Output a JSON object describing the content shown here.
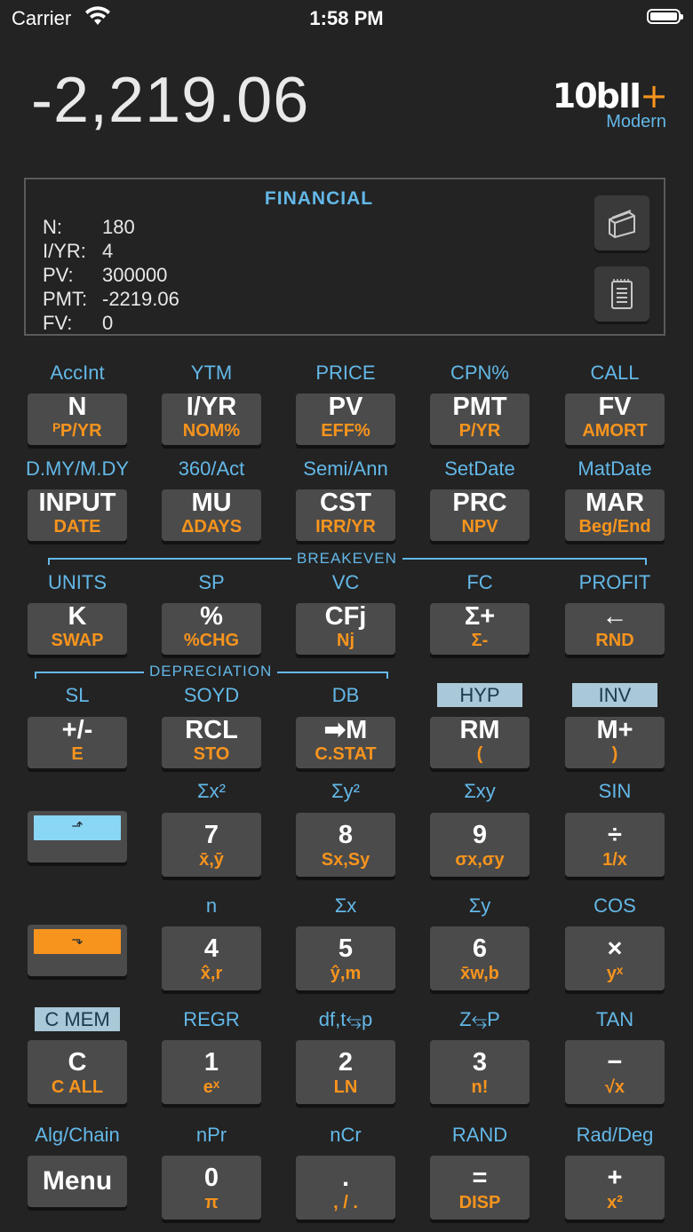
{
  "status": {
    "carrier": "Carrier",
    "time": "1:58 PM"
  },
  "display": {
    "value": "-2,219.06"
  },
  "logo": {
    "brand": "10bII",
    "plus": "+",
    "sub": "Modern"
  },
  "panel": {
    "title": "FINANCIAL",
    "rows": [
      {
        "k": "N:",
        "v": "180"
      },
      {
        "k": "I/YR:",
        "v": "4"
      },
      {
        "k": "PV:",
        "v": "300000"
      },
      {
        "k": "PMT:",
        "v": "-2219.06"
      },
      {
        "k": "FV:",
        "v": "0"
      }
    ]
  },
  "brackets": {
    "breakeven": "BREAKEVEN",
    "depreciation": "DEPRECIATION"
  },
  "rows": [
    {
      "labels": [
        "AccInt",
        "YTM",
        "PRICE",
        "CPN%",
        "CALL"
      ],
      "keys": [
        [
          "N",
          "ᴾP/YR"
        ],
        [
          "I/YR",
          "NOM%"
        ],
        [
          "PV",
          "EFF%"
        ],
        [
          "PMT",
          "P/YR"
        ],
        [
          "FV",
          "AMORT"
        ]
      ]
    },
    {
      "labels": [
        "D.MY/M.DY",
        "360/Act",
        "Semi/Ann",
        "SetDate",
        "MatDate"
      ],
      "keys": [
        [
          "INPUT",
          "DATE"
        ],
        [
          "MU",
          "ΔDAYS"
        ],
        [
          "CST",
          "IRR/YR"
        ],
        [
          "PRC",
          "NPV"
        ],
        [
          "MAR",
          "Beg/End"
        ]
      ]
    },
    {
      "labels": [
        "UNITS",
        "SP",
        "VC",
        "FC",
        "PROFIT"
      ],
      "keys": [
        [
          "K",
          "SWAP"
        ],
        [
          "%",
          "%CHG"
        ],
        [
          "CFj",
          "Nj"
        ],
        [
          "Σ+",
          "Σ-"
        ],
        [
          "←",
          "RND"
        ]
      ]
    },
    {
      "labels": [
        "SL",
        "SOYD",
        "DB",
        "HYP",
        "INV"
      ],
      "keys": [
        [
          "+/-",
          "E"
        ],
        [
          "RCL",
          "STO"
        ],
        [
          "➡M",
          "C.STAT"
        ],
        [
          "RM",
          "("
        ],
        [
          "M+",
          ")"
        ]
      ]
    },
    {
      "labels": [
        "",
        "Σx²",
        "Σy²",
        "Σxy",
        "SIN"
      ],
      "keys": [
        [
          "",
          ""
        ],
        [
          "7",
          "x̄,ȳ"
        ],
        [
          "8",
          "Sx,Sy"
        ],
        [
          "9",
          "σx,σy"
        ],
        [
          "÷",
          "1/x"
        ]
      ]
    },
    {
      "labels": [
        "",
        "n",
        "Σx",
        "Σy",
        "COS"
      ],
      "keys": [
        [
          "",
          ""
        ],
        [
          "4",
          "x̂,r"
        ],
        [
          "5",
          "ŷ,m"
        ],
        [
          "6",
          "x̄w,b"
        ],
        [
          "×",
          "yˣ"
        ]
      ]
    },
    {
      "labels": [
        "C MEM",
        "REGR",
        "df,t⥃p",
        "Z⥃P",
        "TAN"
      ],
      "keys": [
        [
          "C",
          "C ALL"
        ],
        [
          "1",
          "eˣ"
        ],
        [
          "2",
          "LN"
        ],
        [
          "3",
          "n!"
        ],
        [
          "−",
          "√x"
        ]
      ]
    },
    {
      "labels": [
        "Alg/Chain",
        "nPr",
        "nCr",
        "RAND",
        "Rad/Deg"
      ],
      "keys": [
        [
          "Menu",
          ""
        ],
        [
          "0",
          "π"
        ],
        [
          ".",
          ", / ."
        ],
        [
          "=",
          "DISP"
        ],
        [
          "+",
          "x²"
        ]
      ]
    }
  ],
  "shift_keys": {
    "blue": "⬏",
    "orange": "⬎"
  },
  "colors": {
    "blue": "#63b8e8",
    "orange": "#f7941d",
    "key": "#4b4b4b",
    "bg": "#232323"
  }
}
